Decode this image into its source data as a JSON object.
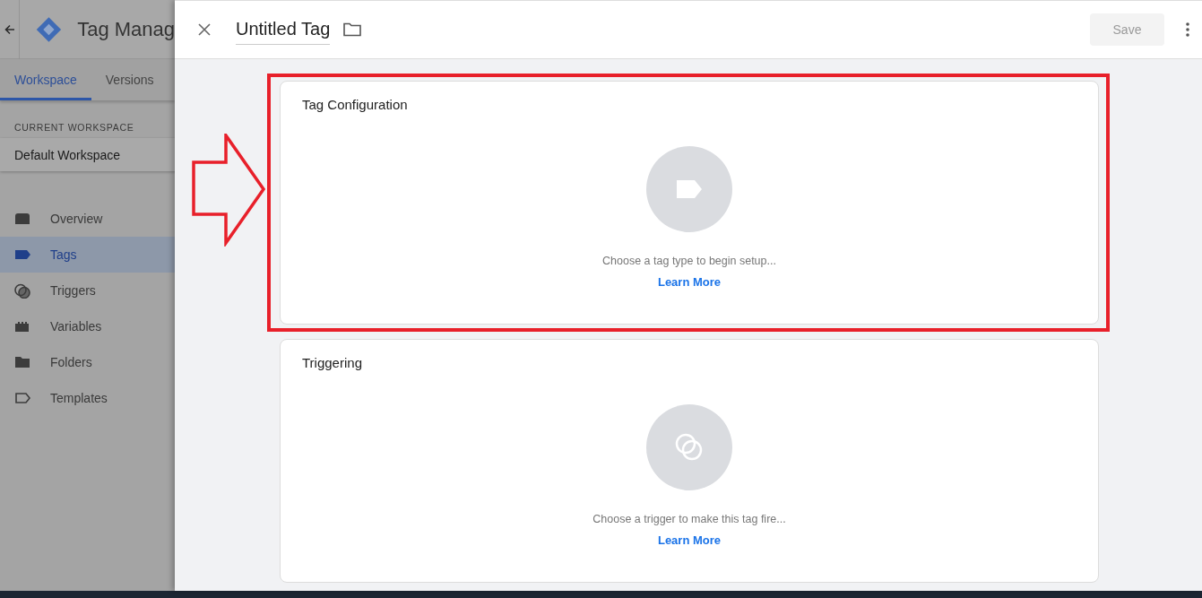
{
  "sidebar": {
    "app_title": "Tag Manag",
    "tabs": [
      {
        "label": "Workspace",
        "selected": true
      },
      {
        "label": "Versions",
        "selected": false
      }
    ],
    "workspace_label": "CURRENT WORKSPACE",
    "workspace_name": "Default Workspace",
    "nav": [
      {
        "kind": "overview",
        "label": "Overview",
        "selected": false
      },
      {
        "kind": "tags",
        "label": "Tags",
        "selected": true
      },
      {
        "kind": "triggers",
        "label": "Triggers",
        "selected": false
      },
      {
        "kind": "variables",
        "label": "Variables",
        "selected": false
      },
      {
        "kind": "folders",
        "label": "Folders",
        "selected": false
      },
      {
        "kind": "templates",
        "label": "Templates",
        "selected": false
      }
    ]
  },
  "header": {
    "title": "Untitled Tag",
    "save_button": {
      "label": "Save",
      "disabled": true
    }
  },
  "cards": [
    {
      "kind": "tag",
      "title": "Tag Configuration",
      "message": "Choose a tag type to begin setup...",
      "link": "Learn More",
      "highlighted": true
    },
    {
      "kind": "trigger",
      "title": "Triggering",
      "message": "Choose a trigger to make this tag fire...",
      "link": "Learn More",
      "highlighted": false
    }
  ]
}
